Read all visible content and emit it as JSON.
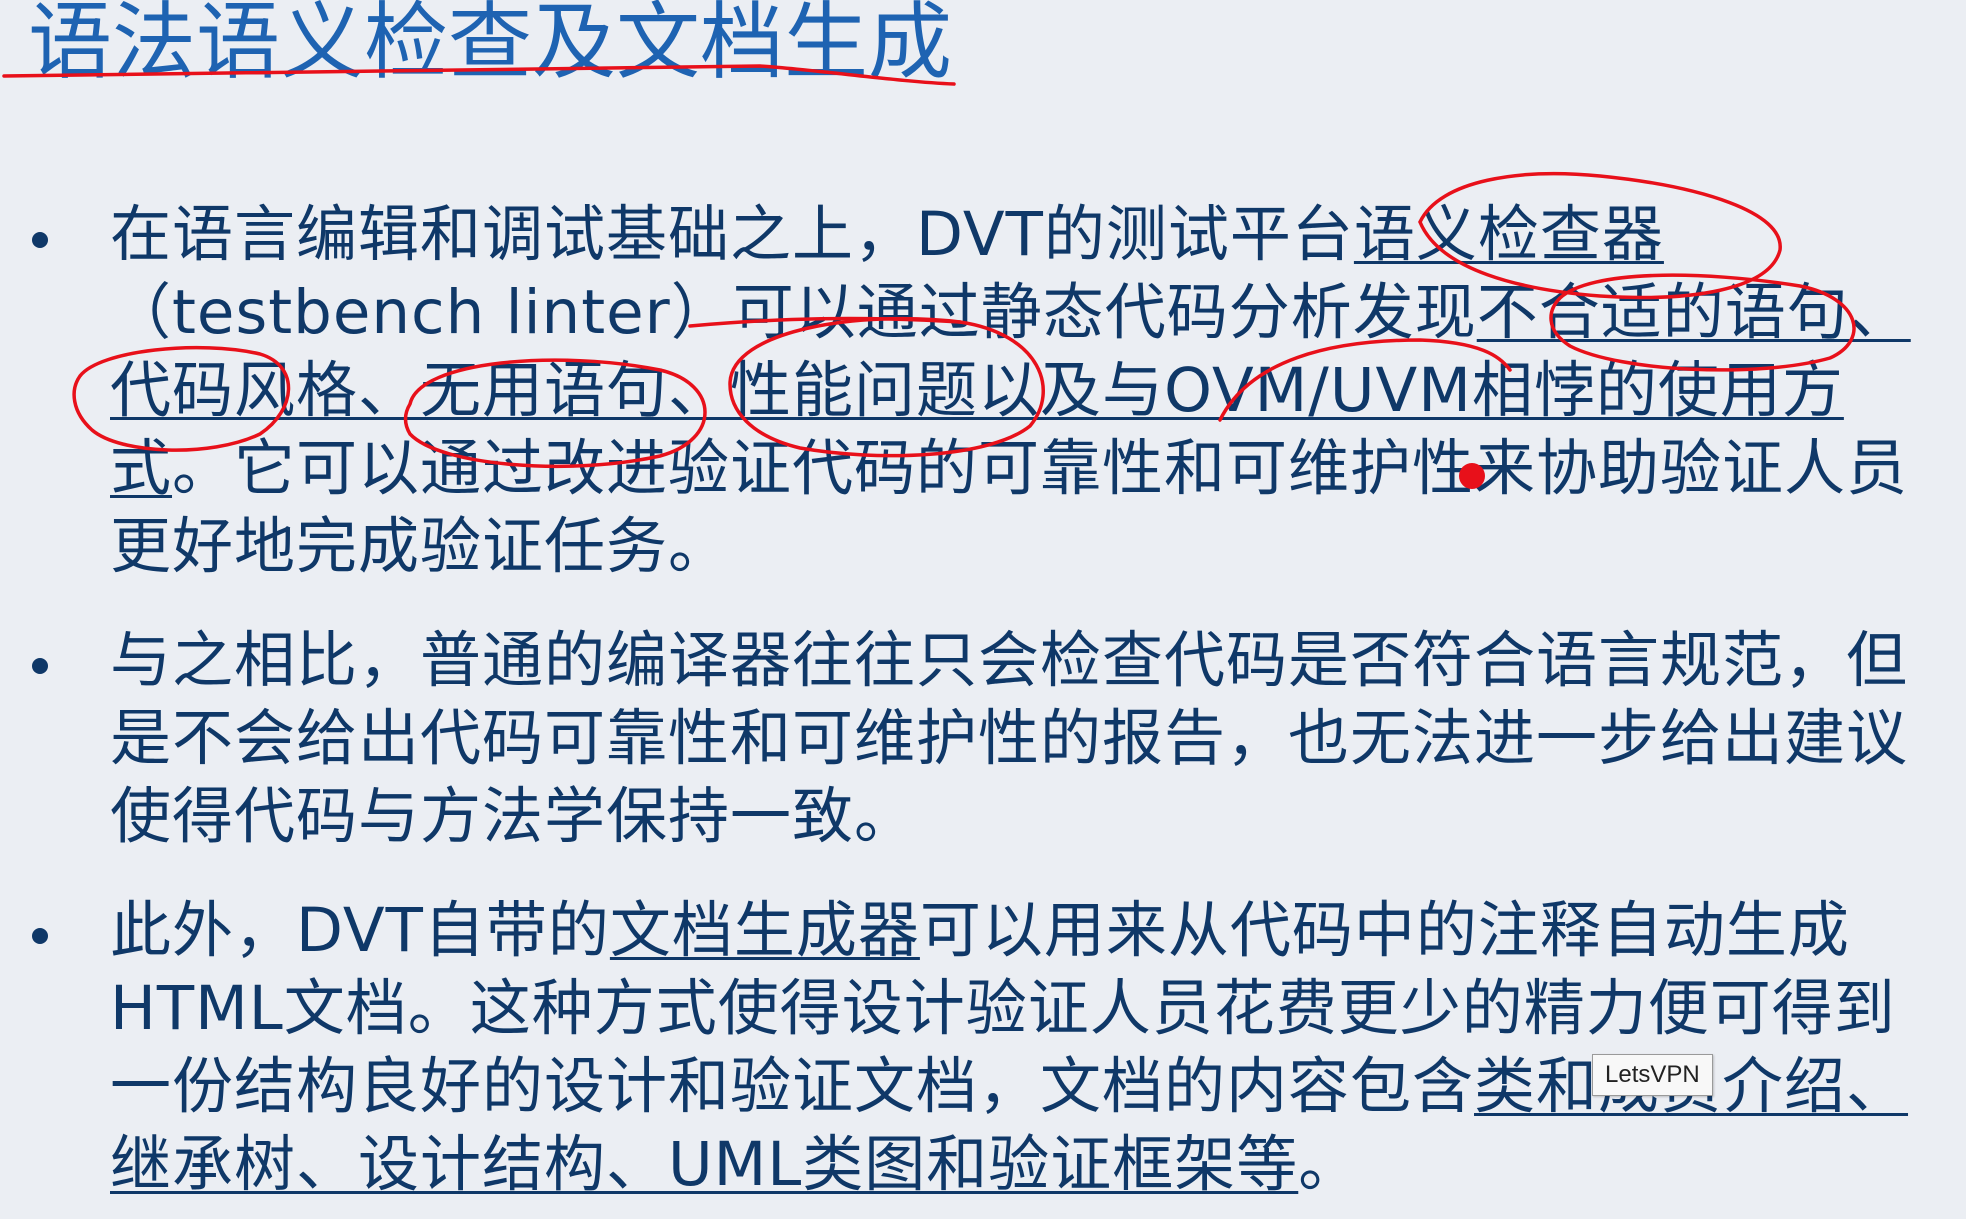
{
  "slide": {
    "title": "语法语义检查及文档生成",
    "bullets": [
      {
        "parts": [
          {
            "text": "在语言编辑和调试基础之上，DVT的测试平台",
            "underline": false
          },
          {
            "text": "语义检查器",
            "underline": true
          },
          {
            "text": "（testbench linter）可以通过静态代码分析发现",
            "underline": false
          },
          {
            "text": "不合适的语句、代码风格、无用语句、性能问题以及与OVM/UVM相悖的使用方式",
            "underline": true
          },
          {
            "text": "。它可以通过改进验证代码的可靠性和可维护性来协助验证人员更好地完成验证任务。",
            "underline": false
          }
        ]
      },
      {
        "parts": [
          {
            "text": "与之相比，普通的编译器往往只会检查代码是否符合语言规范，但是不会给出代码可靠性和可维护性的报告，也无法进一步给出建议使得代码与方法学保持一致。",
            "underline": false
          }
        ]
      },
      {
        "parts": [
          {
            "text": "此外，DVT自带的",
            "underline": false
          },
          {
            "text": "文档生成器",
            "underline": true
          },
          {
            "text": "可以用来从代码中的注释自动生成HTML文档。这种方式使得设计验证人员花费更少的精力便可得到一份结构良好的设计和验证文档，文档的内容包含",
            "underline": false
          },
          {
            "text": "类和成员介绍、继承树、设计结构、UML类图和验证框架等",
            "underline": true
          },
          {
            "text": "。",
            "underline": false
          }
        ]
      }
    ]
  },
  "tooltip": {
    "label": "LetsVPN"
  },
  "colors": {
    "background": "#ebeef3",
    "title": "#1e63b2",
    "body_text": "#0f3868",
    "annotation_ink": "#e8101a"
  }
}
